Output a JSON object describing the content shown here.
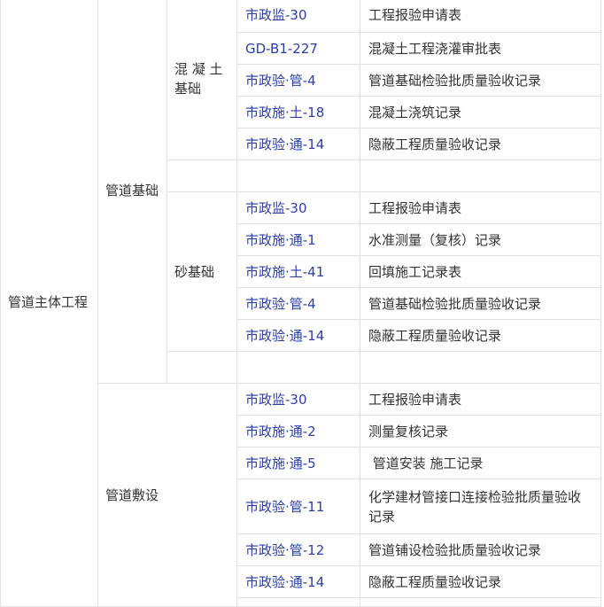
{
  "table": {
    "main_category": "管道主体工程",
    "sections": [
      {
        "name": "管道基础",
        "subgroups": [
          {
            "name": "混 凝 土 基础",
            "rows": [
              {
                "code": "市政监-30",
                "name": "工程报验申请表"
              },
              {
                "code": "GD-B1-227",
                "name": "混凝土工程浇灌审批表"
              },
              {
                "code": "市政验·管-4",
                "name": "管道基础检验批质量验收记录"
              },
              {
                "code": "市政施·土-18",
                "name": "混凝土浇筑记录"
              },
              {
                "code": "市政验·通-14",
                "name": "隐蔽工程质量验收记录"
              }
            ]
          },
          {
            "name": "砂基础",
            "rows": [
              {
                "code": "市政监-30",
                "name": "工程报验申请表"
              },
              {
                "code": "市政施·通-1",
                "name": "水准测量（复核）记录"
              },
              {
                "code": "市政施·土-41",
                "name": "回填施工记录表"
              },
              {
                "code": "市政验·管-4",
                "name": "管道基础检验批质量验收记录"
              },
              {
                "code": "市政验·通-14",
                "name": "隐蔽工程质量验收记录"
              }
            ]
          }
        ]
      },
      {
        "name": "管道敷设",
        "rows": [
          {
            "code": "市政监-30",
            "name": "工程报验申请表"
          },
          {
            "code": "市政施·通-2",
            "name": "测量复核记录"
          },
          {
            "code": "市政施·通-5",
            "name": " 管道安装 施工记录"
          },
          {
            "code": "市政验·管-11",
            "name": "化学建材管接口连接检验批质量验收记录"
          },
          {
            "code": "市政验·管-12",
            "name": "管道铺设检验批质量验收记录"
          },
          {
            "code": "市政验·通-14",
            "name": "隐蔽工程质量验收记录"
          }
        ]
      }
    ]
  },
  "colors": {
    "code_text": "#2b3ea8",
    "body_text": "#333333",
    "border": "#e3e3e3"
  }
}
